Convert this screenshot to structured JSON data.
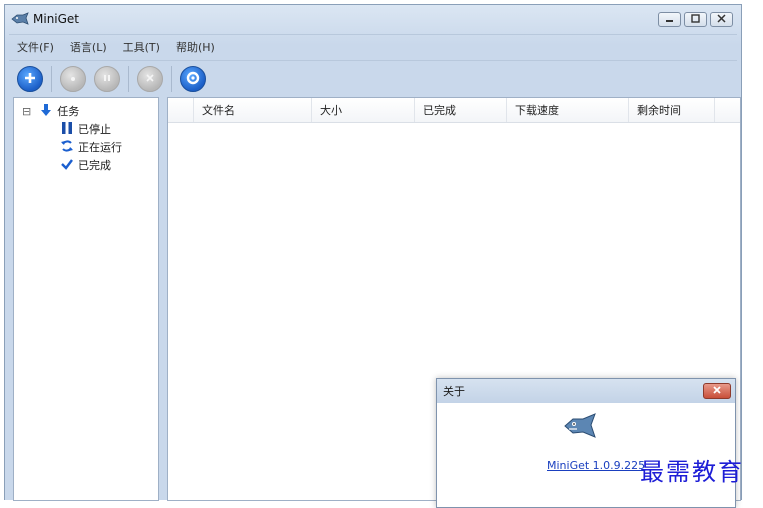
{
  "window": {
    "title": "MiniGet"
  },
  "menu": [
    {
      "label": "文件(F)"
    },
    {
      "label": "语言(L)"
    },
    {
      "label": "工具(T)"
    },
    {
      "label": "帮助(H)"
    }
  ],
  "toolbar": {
    "buttons": [
      {
        "icon": "add-icon",
        "state": "enabled"
      },
      {
        "icon": "start-icon",
        "state": "disabled"
      },
      {
        "icon": "pause-icon",
        "state": "disabled"
      },
      {
        "icon": "delete-icon",
        "state": "disabled"
      },
      {
        "icon": "settings-icon",
        "state": "enabled"
      }
    ]
  },
  "tree": {
    "expander": "⊟",
    "root": {
      "label": "任务",
      "icon": "download-arrow-icon"
    },
    "children": [
      {
        "label": "已停止",
        "icon": "pause-icon"
      },
      {
        "label": "正在运行",
        "icon": "refresh-icon"
      },
      {
        "label": "已完成",
        "icon": "check-icon"
      }
    ]
  },
  "list": {
    "columns": [
      {
        "label": "文件名"
      },
      {
        "label": "大小"
      },
      {
        "label": "已完成"
      },
      {
        "label": "下载速度"
      },
      {
        "label": "剩余时间"
      }
    ],
    "rows": []
  },
  "about_dialog": {
    "title": "关于",
    "link": "MiniGet 1.0.9.225",
    "close_icon": "close-icon"
  },
  "watermark": "最需教育",
  "colors": {
    "accent": "#1c5fc7",
    "close": "#c84f3a",
    "watermark": "#1d1dd6"
  }
}
